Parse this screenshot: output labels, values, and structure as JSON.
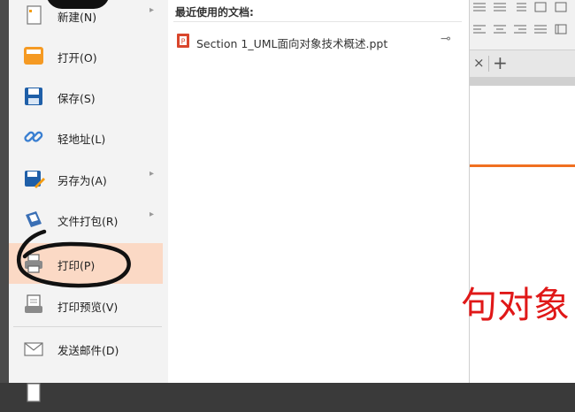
{
  "menu": {
    "items": [
      {
        "label": "新建(N)",
        "icon": "new-document-icon",
        "has_submenu": true
      },
      {
        "label": "打开(O)",
        "icon": "open-folder-icon",
        "has_submenu": false
      },
      {
        "label": "保存(S)",
        "icon": "save-icon",
        "has_submenu": false
      },
      {
        "label": "轻地址(L)",
        "icon": "link-icon",
        "has_submenu": false
      },
      {
        "label": "另存为(A)",
        "icon": "save-as-icon",
        "has_submenu": true
      },
      {
        "label": "文件打包(R)",
        "icon": "package-icon",
        "has_submenu": true
      },
      {
        "label": "打印(P)",
        "icon": "printer-icon",
        "has_submenu": false,
        "active": true
      },
      {
        "label": "打印预览(V)",
        "icon": "print-preview-icon",
        "has_submenu": false
      },
      {
        "label": "发送邮件(D)",
        "icon": "mail-icon",
        "has_submenu": false
      }
    ],
    "submenu_arrow": "▸"
  },
  "recent": {
    "title": "最近使用的文档:",
    "documents": [
      {
        "name": "Section 1_UML面向对象技术概述.ppt",
        "icon": "ppt-file-icon",
        "pin": "⊸"
      }
    ]
  },
  "tabbar": {
    "close": "×",
    "add": "+"
  },
  "slide": {
    "visible_text": "句对象"
  },
  "colors": {
    "active_item_bg": "#fbd9c5",
    "accent_orange": "#f07020",
    "slide_text_red": "#e01818",
    "annotation_ink": "#111111"
  }
}
